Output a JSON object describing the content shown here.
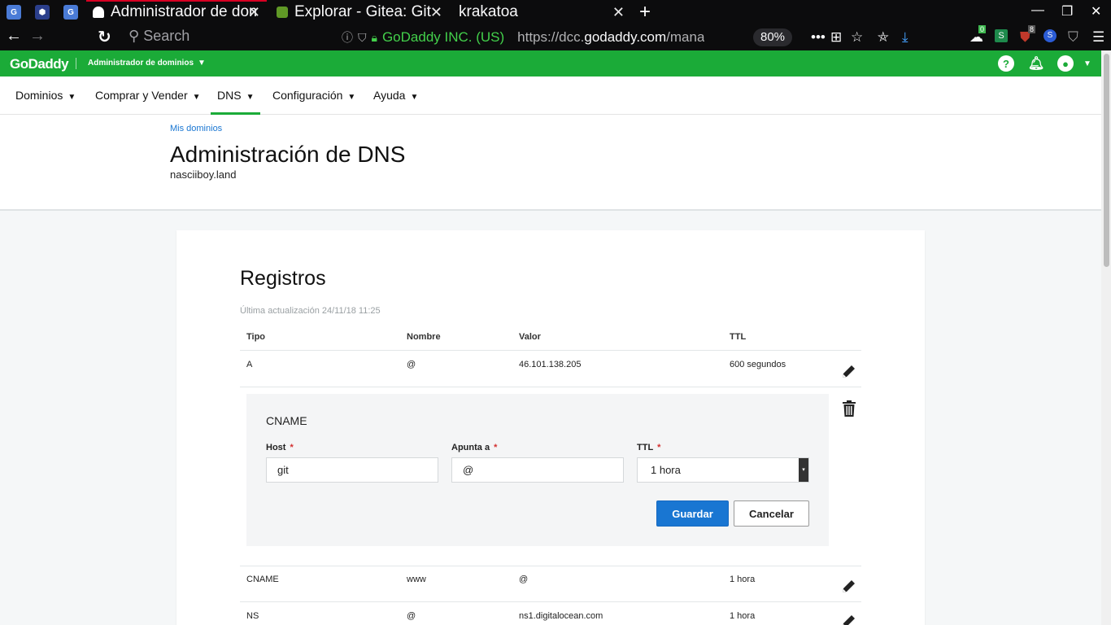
{
  "browser": {
    "tabs": [
      {
        "title": "Administrador de dominios",
        "active": true
      },
      {
        "title": "Explorar - Gitea: Git with a cup of tea",
        "active": false
      },
      {
        "title": "krakatoa",
        "active": false
      }
    ],
    "search_placeholder": "Search",
    "site_identity": "GoDaddy INC. (US)",
    "url_prefix": "https://dcc.",
    "url_domain": "godaddy.com",
    "url_rest": "/manage/nasciiboy.land/dns",
    "zoom": "80%",
    "badges": {
      "ext_green": "0",
      "ublock": "8"
    }
  },
  "header": {
    "logo": "GoDaddy",
    "app_name": "Administrador de dominios"
  },
  "nav": {
    "items": [
      {
        "label": "Dominios"
      },
      {
        "label": "Comprar y Vender"
      },
      {
        "label": "DNS"
      },
      {
        "label": "Configuración"
      },
      {
        "label": "Ayuda"
      }
    ]
  },
  "page": {
    "breadcrumb": "Mis dominios",
    "title": "Administración de DNS",
    "domain": "nasciiboy.land"
  },
  "records": {
    "title": "Registros",
    "updated": "Última actualización 24/11/18 11:25",
    "columns": [
      "Tipo",
      "Nombre",
      "Valor",
      "TTL"
    ],
    "rows": [
      {
        "type": "A",
        "name": "@",
        "value": "46.101.138.205",
        "ttl": "600 segundos"
      },
      {
        "type": "CNAME",
        "name": "www",
        "value": "@",
        "ttl": "1 hora"
      },
      {
        "type": "NS",
        "name": "@",
        "value": "ns1.digitalocean.com",
        "ttl": "1 hora"
      }
    ],
    "editor": {
      "type": "CNAME",
      "host_label": "Host",
      "host_value": "git",
      "points_label": "Apunta a",
      "points_value": "@",
      "ttl_label": "TTL",
      "ttl_value": "1 hora",
      "required_mark": "*",
      "save": "Guardar",
      "cancel": "Cancelar"
    }
  },
  "colors": {
    "brand_green": "#1bab38",
    "primary_blue": "#1976d2",
    "required_red": "#d32f2f"
  }
}
